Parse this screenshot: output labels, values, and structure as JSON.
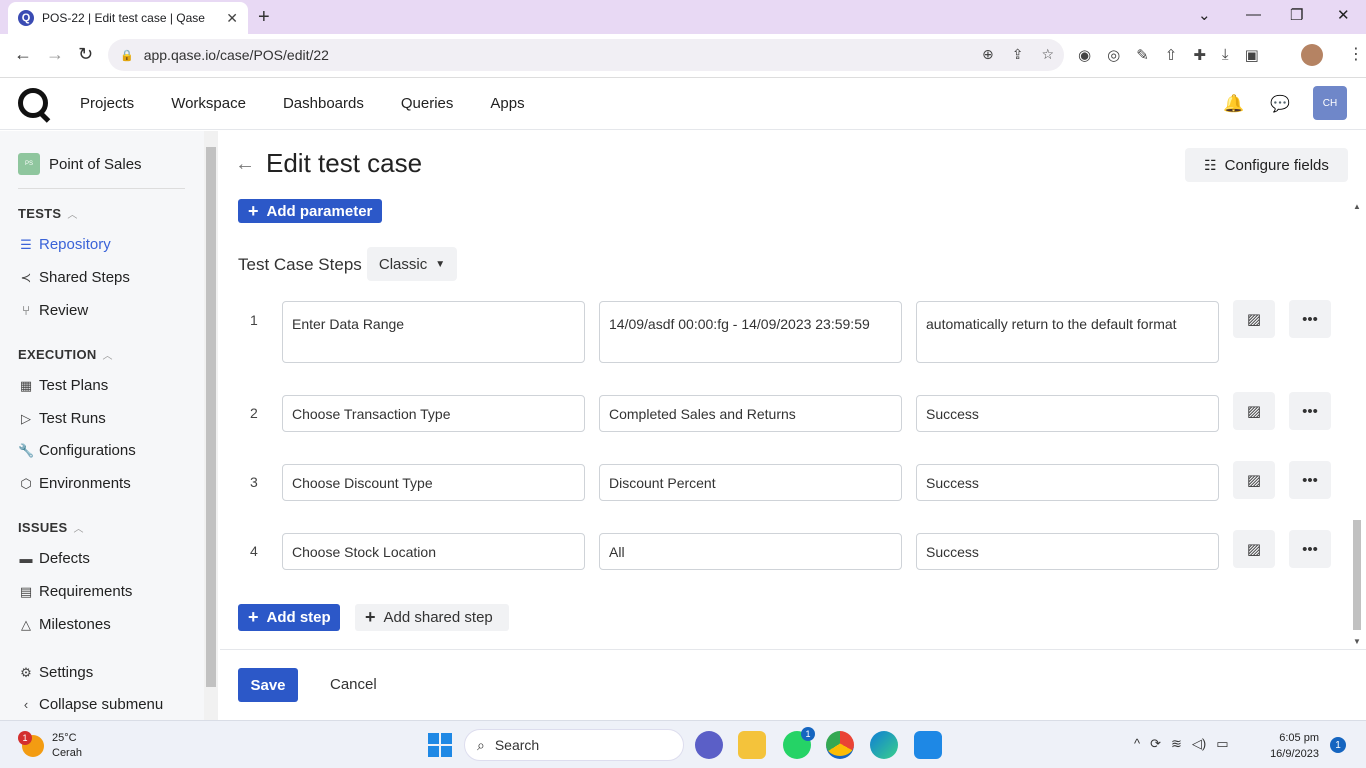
{
  "browser": {
    "tab_title": "POS-22 | Edit test case | Qase",
    "url": "app.qase.io/case/POS/edit/22"
  },
  "header": {
    "nav": [
      "Projects",
      "Workspace",
      "Dashboards",
      "Queries",
      "Apps"
    ],
    "user_initials": "CH"
  },
  "sidebar": {
    "project_badge": "PS",
    "project_name": "Point of Sales",
    "sections": {
      "tests": "TESTS",
      "execution": "EXECUTION",
      "issues": "ISSUES"
    },
    "items": {
      "repository": "Repository",
      "shared_steps": "Shared Steps",
      "review": "Review",
      "test_plans": "Test Plans",
      "test_runs": "Test Runs",
      "configurations": "Configurations",
      "environments": "Environments",
      "defects": "Defects",
      "requirements": "Requirements",
      "milestones": "Milestones",
      "settings": "Settings",
      "collapse": "Collapse submenu"
    }
  },
  "main": {
    "title": "Edit test case",
    "configure_fields": "Configure fields",
    "add_parameter": "Add parameter",
    "steps_title": "Test Case Steps",
    "steps_mode": "Classic",
    "steps": [
      {
        "num": "1",
        "action": "Enter Data Range",
        "data": "14/09/asdf 00:00:fg - 14/09/2023 23:59:59",
        "expected": "automatically return to the default format"
      },
      {
        "num": "2",
        "action": "Choose Transaction Type",
        "data": "Completed Sales and Returns",
        "expected": "Success"
      },
      {
        "num": "3",
        "action": "Choose Discount Type",
        "data": "Discount Percent",
        "expected": "Success"
      },
      {
        "num": "4",
        "action": "Choose Stock Location",
        "data": "All",
        "expected": "Success"
      }
    ],
    "add_step": "Add step",
    "add_shared_step": "Add shared step",
    "save": "Save",
    "cancel": "Cancel"
  },
  "taskbar": {
    "weather_badge": "1",
    "temperature": "25°C",
    "weather_desc": "Cerah",
    "search_label": "Search",
    "whatsapp_badge": "1",
    "time": "6:05 pm",
    "date": "16/9/2023",
    "notification_count": "1"
  },
  "colors": {
    "primary": "#2c58c8",
    "sidebar_active": "#3a63d8",
    "tab_strip": "#e8d9f4"
  }
}
